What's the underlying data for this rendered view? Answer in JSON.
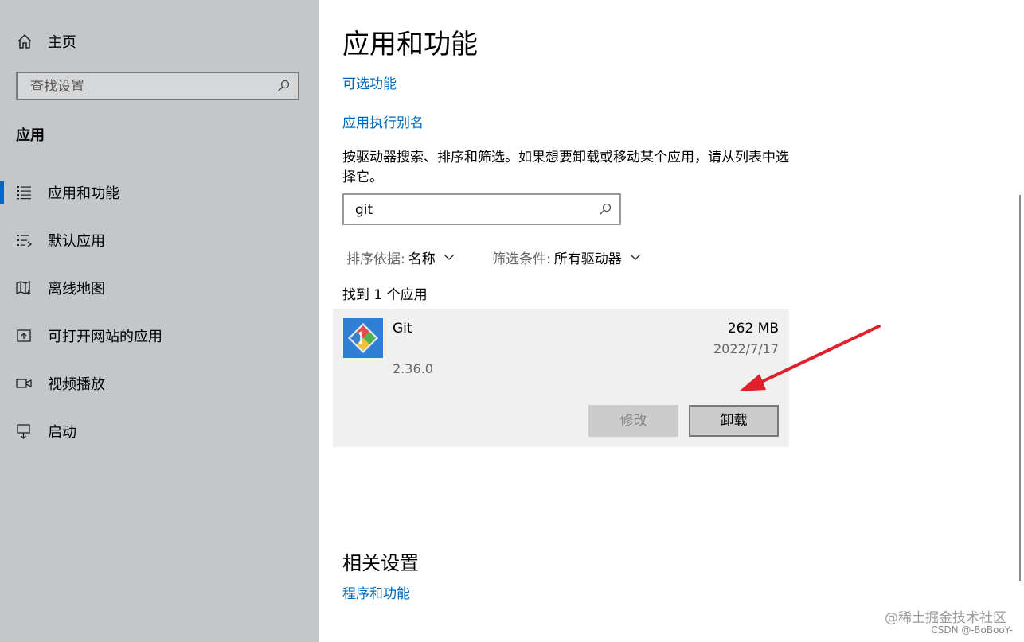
{
  "sidebar": {
    "home_label": "主页",
    "search_placeholder": "查找设置",
    "section_title": "应用",
    "items": [
      {
        "label": "应用和功能",
        "icon": "apps-features-icon"
      },
      {
        "label": "默认应用",
        "icon": "default-apps-icon"
      },
      {
        "label": "离线地图",
        "icon": "offline-maps-icon"
      },
      {
        "label": "可打开网站的应用",
        "icon": "apps-for-websites-icon"
      },
      {
        "label": "视频播放",
        "icon": "video-playback-icon"
      },
      {
        "label": "启动",
        "icon": "startup-icon"
      }
    ]
  },
  "main": {
    "title": "应用和功能",
    "optional_features_link": "可选功能",
    "app_alias_link": "应用执行别名",
    "description": "按驱动器搜索、排序和筛选。如果想要卸载或移动某个应用，请从列表中选择它。",
    "search_value": "git",
    "sort_label": "排序依据:",
    "sort_value": "名称",
    "filter_label": "筛选条件:",
    "filter_value": "所有驱动器",
    "found_text": "找到 1 个应用",
    "app": {
      "name": "Git",
      "version": "2.36.0",
      "size": "262 MB",
      "date": "2022/7/17",
      "modify_label": "修改",
      "uninstall_label": "卸载"
    },
    "related_title": "相关设置",
    "programs_link": "程序和功能"
  },
  "watermark": {
    "line1": "@稀土掘金技术社区",
    "line2": "CSDN @-BoBooY-"
  },
  "colors": {
    "sidebar_bg": "#c4c7ca",
    "accent": "#0067c0",
    "link": "#0067b8",
    "arrow": "#e0202a"
  }
}
